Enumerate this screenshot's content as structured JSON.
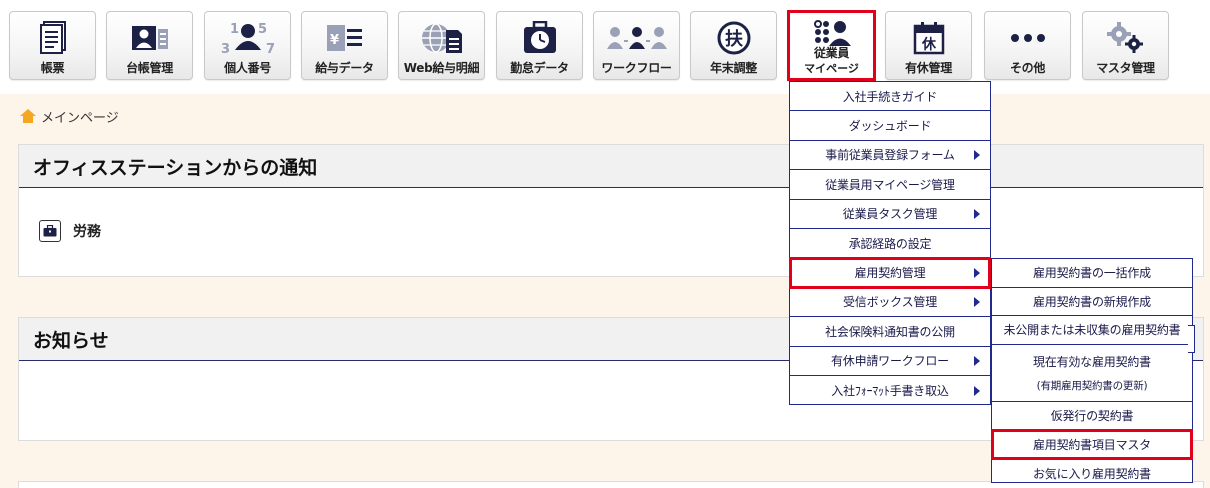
{
  "toolbar": {
    "items": [
      {
        "label": "帳票",
        "icon": "document-icon"
      },
      {
        "label": "台帳管理",
        "icon": "ledger-icon"
      },
      {
        "label": "個人番号",
        "icon": "personal-number-icon"
      },
      {
        "label": "給与データ",
        "icon": "payroll-icon"
      },
      {
        "label": "Web給与明細",
        "icon": "web-payslip-icon"
      },
      {
        "label": "勤怠データ",
        "icon": "attendance-icon"
      },
      {
        "label": "ワークフロー",
        "icon": "workflow-icon"
      },
      {
        "label": "年末調整",
        "icon": "year-end-icon"
      },
      {
        "label": "従業員",
        "label2": "マイページ",
        "icon": "employee-mypage-icon"
      },
      {
        "label": "有休管理",
        "icon": "paid-leave-icon"
      },
      {
        "label": "その他",
        "icon": "more-icon"
      },
      {
        "label": "マスタ管理",
        "icon": "master-settings-icon"
      }
    ],
    "icon_glyphs": {
      "year_end": "扶",
      "leave": "休",
      "digits": [
        "1",
        "5",
        "3",
        "7"
      ],
      "yen": "¥"
    }
  },
  "breadcrumb": {
    "home": "メインページ"
  },
  "notice_panel": {
    "title": "オフィスステーションからの通知",
    "category": "労務"
  },
  "news_panel": {
    "title": "お知らせ"
  },
  "employee_menu": {
    "items": [
      {
        "label": "入社手続きガイド"
      },
      {
        "label": "ダッシュボード"
      },
      {
        "label": "事前従業員登録フォーム"
      },
      {
        "label": "従業員用マイページ管理"
      },
      {
        "label": "従業員タスク管理"
      },
      {
        "label": "承認経路の設定"
      },
      {
        "label": "雇用契約管理"
      },
      {
        "label": "受信ボックス管理"
      },
      {
        "label": "社会保険料通知書の公開"
      },
      {
        "label": "有休申請ワークフロー"
      },
      {
        "label": "入社ﾌｫｰﾏｯﾄ手書き取込"
      }
    ]
  },
  "contract_menu": {
    "items": [
      {
        "label": "雇用契約書の一括作成"
      },
      {
        "label": "雇用契約書の新規作成"
      },
      {
        "label": "未公開または未収集の雇用契約書"
      },
      {
        "label": "現在有効な雇用契約書",
        "sub": "(有期雇用契約書の更新)"
      },
      {
        "label": "仮発行の契約書"
      },
      {
        "label": "雇用契約書項目マスタ"
      },
      {
        "label": "お気に入り雇用契約書"
      }
    ]
  },
  "colors": {
    "highlight": "#e0001b",
    "menu_border": "#1f2a8c",
    "page_bg": "#fdf5ea",
    "icon_dark": "#1c2145"
  }
}
